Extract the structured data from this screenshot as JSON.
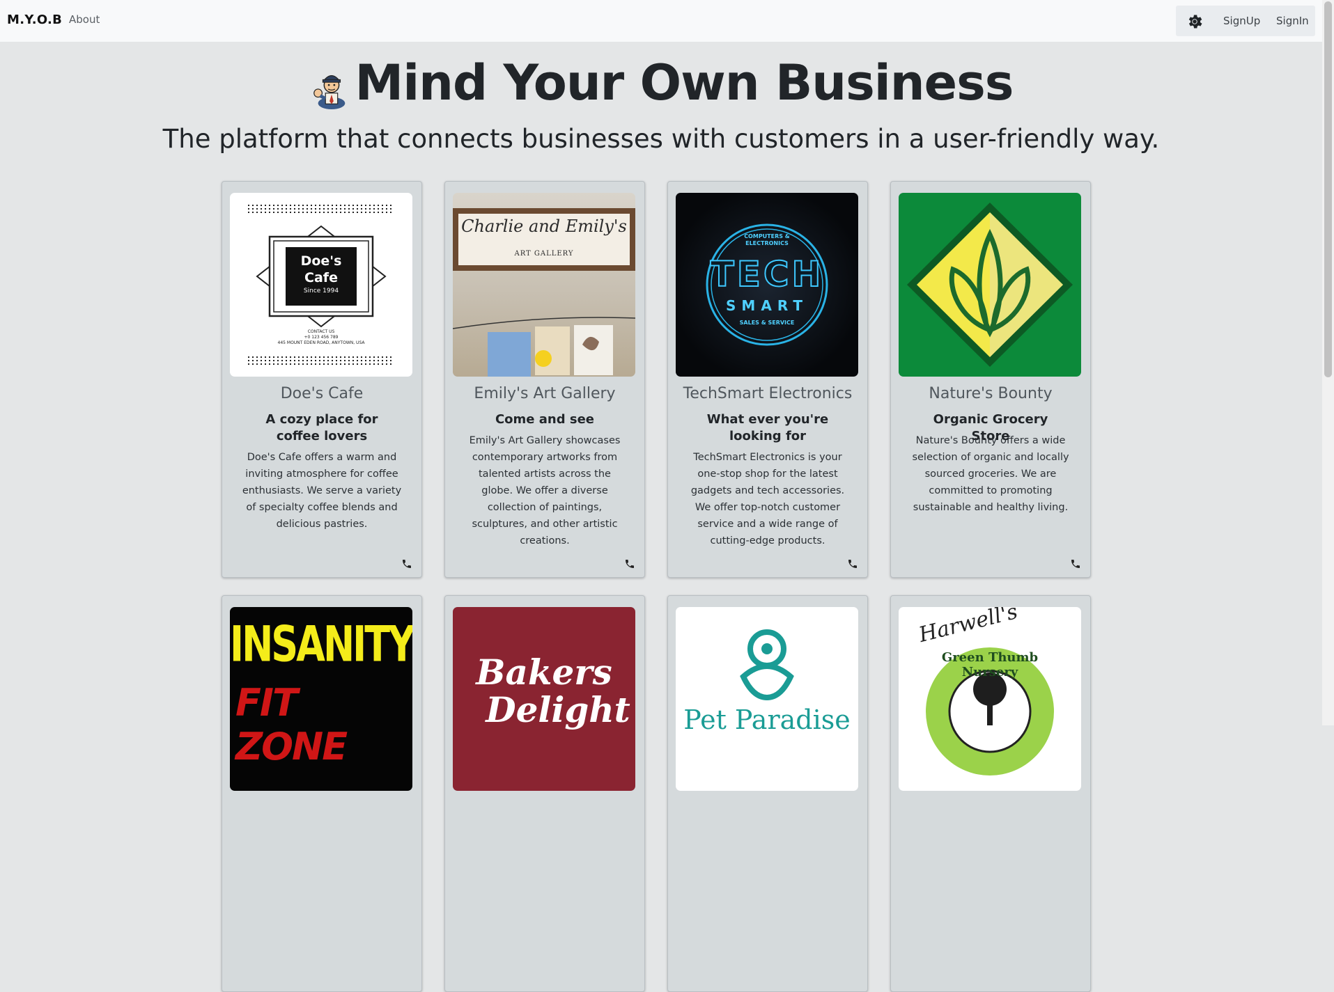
{
  "nav": {
    "brand": "M.Y.O.B",
    "about": "About",
    "signup": "SignUp",
    "signin": "SignIn",
    "theme_icon": "gear-icon"
  },
  "hero": {
    "title": "Mind Your Own Business",
    "tagline": "The platform that connects businesses with customers in a user-friendly way."
  },
  "cards": [
    {
      "name": "Doe's Cafe",
      "subtitle": "A cozy place for coffee lovers",
      "description": "Doe's Cafe offers a warm and inviting atmosphere for coffee enthusiasts. We serve a variety of specialty coffee blends and delicious pastries.",
      "logo_text_1": "Doe's",
      "logo_text_2": "Cafe",
      "logo_since": "Since 1994",
      "logo_contact": "CONTACT US",
      "logo_phone": "+0 123 456 789",
      "logo_address": "445 MOUNT EDEN ROAD, ANYTOWN, USA"
    },
    {
      "name": "Emily's Art Gallery",
      "subtitle": "Come and see",
      "description": "Emily's Art Gallery showcases contemporary artworks from talented artists across the globe. We offer a diverse collection of paintings, sculptures, and other artistic creations.",
      "sign_text": "Charlie and Emily's",
      "sign_sub": "ART GALLERY"
    },
    {
      "name": "TechSmart Electronics",
      "subtitle": "What ever you're looking for",
      "description": "TechSmart Electronics is your one-stop shop for the latest gadgets and tech accessories. We offer top-notch customer service and a wide range of cutting-edge products.",
      "logo_top": "COMPUTERS & ELECTRONICS",
      "logo_tech": "TECH",
      "logo_smart": "SMART",
      "logo_bottom": "SALES & SERVICE"
    },
    {
      "name": "Nature's Bounty",
      "subtitle": "Organic Grocery Store",
      "description": "Nature's Bounty offers a wide selection of organic and locally sourced groceries. We are committed to promoting sustainable and healthy living."
    },
    {
      "logo_line1": "INSANITY",
      "logo_line2": "FIT ZONE"
    },
    {
      "logo_line1": "Bakers",
      "logo_line2": "Delight"
    },
    {
      "logo_text": "Pet Paradise"
    },
    {
      "logo_line1": "Harwell's",
      "logo_line2": "Green Thumb Nursery"
    }
  ]
}
